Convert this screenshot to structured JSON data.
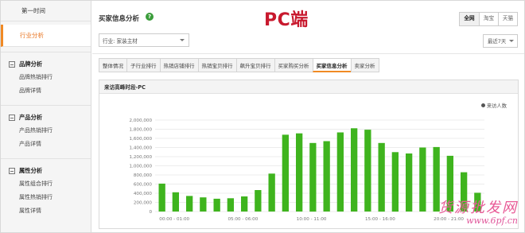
{
  "sidebar": {
    "top": "第一时间",
    "active": "行业分析",
    "groups": [
      {
        "title": "品牌分析",
        "items": [
          "品牌热销排行",
          "品牌详情"
        ]
      },
      {
        "title": "产品分析",
        "items": [
          "产品热销排行",
          "产品详情"
        ]
      },
      {
        "title": "属性分析",
        "items": [
          "属性组合排行",
          "属性热销排行",
          "属性详情"
        ]
      }
    ]
  },
  "header": {
    "title": "买家信息分析",
    "help": "?",
    "overlay": "PC端",
    "segments": [
      "全网",
      "淘宝",
      "天猫"
    ]
  },
  "filter": {
    "value": "行业: 家装主材",
    "range": "最近7天"
  },
  "tabs": [
    "整体情况",
    "子行业排行",
    "热销店铺排行",
    "热销宝贝排行",
    "飙升宝贝排行",
    "买家购买分析",
    "买家信息分析",
    "卖家分析"
  ],
  "active_tab": 6,
  "panel": {
    "title": "来访高峰时段-PC"
  },
  "watermark": {
    "line1": "货源批发网",
    "line2": "www.6pf.cn"
  },
  "chart_data": {
    "type": "bar",
    "legend": "来访人数",
    "color": "#3fb41e",
    "ylim": [
      0,
      2000000
    ],
    "yticks": [
      "0",
      "200,000",
      "400,000",
      "600,000",
      "800,000",
      "1,000,000",
      "1,200,000",
      "1,400,000",
      "1,600,000",
      "1,800,000",
      "2,000,000"
    ],
    "xlabels": [
      "00:00 - 01:00",
      "05:00 - 06:00",
      "10:00 - 11:00",
      "15:00 - 16:00",
      "20:00 - 21:00"
    ],
    "categories": [
      "00:00 - 01:00",
      "01:00 - 02:00",
      "02:00 - 03:00",
      "03:00 - 04:00",
      "04:00 - 05:00",
      "05:00 - 06:00",
      "06:00 - 07:00",
      "07:00 - 08:00",
      "08:00 - 09:00",
      "09:00 - 10:00",
      "10:00 - 11:00",
      "11:00 - 12:00",
      "12:00 - 13:00",
      "13:00 - 14:00",
      "14:00 - 15:00",
      "15:00 - 16:00",
      "16:00 - 17:00",
      "17:00 - 18:00",
      "18:00 - 19:00",
      "19:00 - 20:00",
      "20:00 - 21:00",
      "21:00 - 22:00",
      "22:00 - 23:00",
      "23:00 - 24:00"
    ],
    "values": [
      610000,
      420000,
      340000,
      310000,
      280000,
      290000,
      330000,
      470000,
      830000,
      1680000,
      1710000,
      1500000,
      1540000,
      1730000,
      1820000,
      1790000,
      1500000,
      1300000,
      1270000,
      1400000,
      1410000,
      1220000,
      860000,
      410000
    ]
  }
}
